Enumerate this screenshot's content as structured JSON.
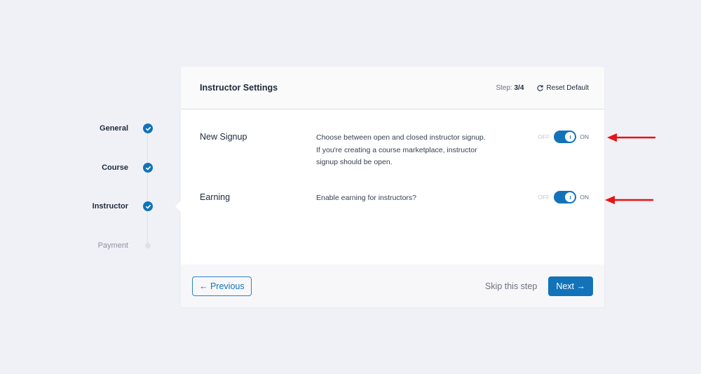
{
  "stepper": {
    "steps": [
      {
        "label": "General",
        "status": "done"
      },
      {
        "label": "Course",
        "status": "done"
      },
      {
        "label": "Instructor",
        "status": "done"
      },
      {
        "label": "Payment",
        "status": "pending"
      }
    ]
  },
  "card": {
    "title": "Instructor Settings",
    "step_prefix": "Step: ",
    "step_count": "3/4",
    "reset_label": "Reset Default",
    "settings": [
      {
        "title": "New Signup",
        "description": "Choose between open and closed instructor signup. If you're creating a course marketplace, instructor signup should be open.",
        "off_label": "OFF",
        "on_label": "ON",
        "enabled": true
      },
      {
        "title": "Earning",
        "description": "Enable earning for instructors?",
        "off_label": "OFF",
        "on_label": "ON",
        "enabled": true
      }
    ]
  },
  "footer": {
    "previous_label": "← Previous",
    "skip_label": "Skip this step",
    "next_label": "Next →"
  },
  "colors": {
    "accent": "#1273b9",
    "background": "#f0f1f6",
    "annotation": "#e81313"
  }
}
